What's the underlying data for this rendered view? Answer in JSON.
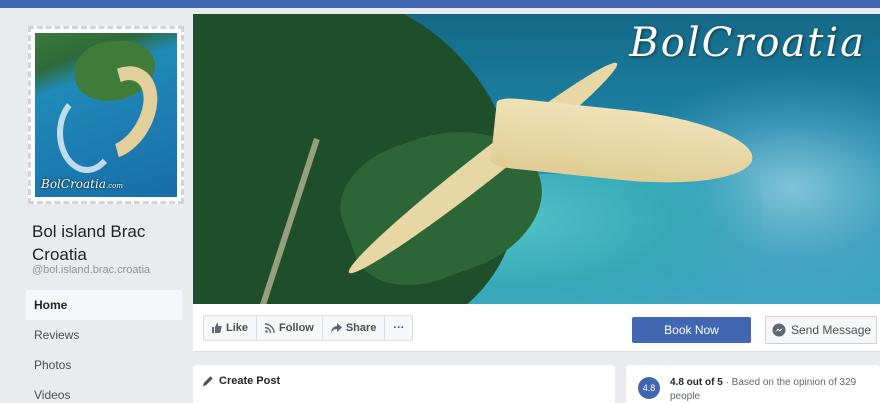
{
  "page": {
    "name": "Bol island Brac Croatia",
    "handle": "@bol.island.brac.croatia",
    "profile_logo_text": "BolCroatia",
    "profile_logo_suffix": ".com"
  },
  "nav": {
    "items": [
      {
        "label": "Home",
        "active": true
      },
      {
        "label": "Reviews",
        "active": false
      },
      {
        "label": "Photos",
        "active": false
      },
      {
        "label": "Videos",
        "active": false
      }
    ]
  },
  "cover": {
    "title": "BolCroatia"
  },
  "actions": {
    "like": "Like",
    "follow": "Follow",
    "share": "Share",
    "more": "···",
    "book": "Book Now",
    "message": "Send Message"
  },
  "create_post": {
    "label": "Create Post"
  },
  "rating": {
    "badge": "4.8",
    "score": "4.8 out of 5",
    "text": " · Based on the opinion of 329 people"
  },
  "colors": {
    "brand": "#4267b2",
    "background": "#e9ebee"
  }
}
